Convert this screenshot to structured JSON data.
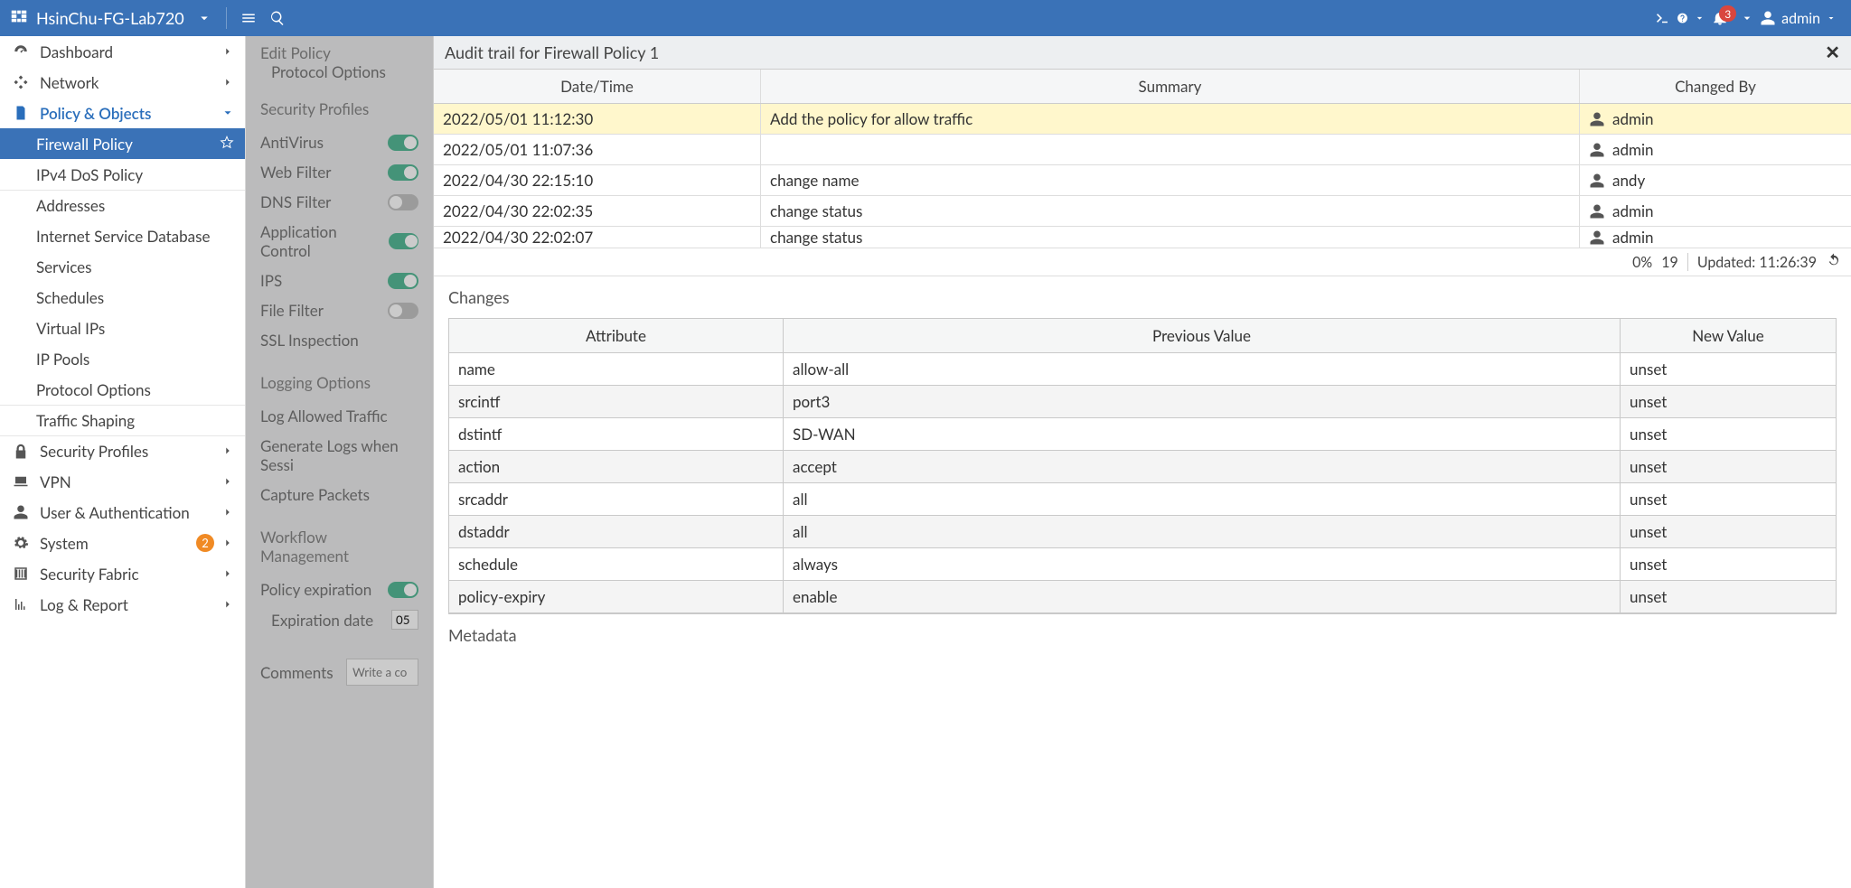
{
  "topbar": {
    "hostname": "HsinChu-FG-Lab720",
    "notif_count": "3",
    "admin_label": "admin"
  },
  "sidebar": {
    "dashboard": "Dashboard",
    "network": "Network",
    "policy_objects": "Policy & Objects",
    "firewall_policy": "Firewall Policy",
    "ipv4_dos": "IPv4 DoS Policy",
    "addresses": "Addresses",
    "isdb": "Internet Service Database",
    "services": "Services",
    "schedules": "Schedules",
    "vip": "Virtual IPs",
    "ippools": "IP Pools",
    "proto_opts": "Protocol Options",
    "traffic_shaping": "Traffic Shaping",
    "security_profiles": "Security Profiles",
    "vpn": "VPN",
    "user_auth": "User & Authentication",
    "system": "System",
    "system_count": "2",
    "security_fabric": "Security Fabric",
    "log_report": "Log & Report"
  },
  "midpanel": {
    "edit_policy": "Edit Policy",
    "protocol_options": "Protocol Options",
    "security_profiles": "Security Profiles",
    "antivirus": "AntiVirus",
    "web_filter": "Web Filter",
    "dns_filter": "DNS Filter",
    "app_control": "Application Control",
    "ips": "IPS",
    "file_filter": "File Filter",
    "ssl_inspection": "SSL Inspection",
    "logging_options": "Logging Options",
    "log_allowed": "Log Allowed Traffic",
    "gen_logs": "Generate Logs when Sessi",
    "capture_packets": "Capture Packets",
    "workflow": "Workflow Management",
    "policy_exp": "Policy expiration",
    "exp_date_label": "Expiration date",
    "exp_date_val": "05",
    "comments": "Comments",
    "comments_ph": "Write a co"
  },
  "panel": {
    "title": "Audit trail for Firewall Policy 1"
  },
  "audit_head": {
    "dt": "Date/Time",
    "sum": "Summary",
    "by": "Changed By"
  },
  "audit_rows": [
    {
      "dt": "2022/05/01 11:12:30",
      "sum": "Add the policy for allow traffic",
      "by": "admin",
      "sel": true
    },
    {
      "dt": "2022/05/01 11:07:36",
      "sum": "",
      "by": "admin"
    },
    {
      "dt": "2022/04/30 22:15:10",
      "sum": "change name",
      "by": "andy"
    },
    {
      "dt": "2022/04/30 22:02:35",
      "sum": "change status",
      "by": "admin"
    },
    {
      "dt": "2022/04/30 22:02:07",
      "sum": "change status",
      "by": "admin"
    }
  ],
  "bar": {
    "pct": "0%",
    "count": "19",
    "updated": "Updated: 11:26:39"
  },
  "changes_h": "Changes",
  "changes_head": {
    "a": "Attribute",
    "p": "Previous Value",
    "n": "New Value"
  },
  "changes": [
    {
      "a": "name",
      "p": "allow-all",
      "n": "unset"
    },
    {
      "a": "srcintf",
      "p": "port3",
      "n": "unset"
    },
    {
      "a": "dstintf",
      "p": "SD-WAN",
      "n": "unset"
    },
    {
      "a": "action",
      "p": "accept",
      "n": "unset"
    },
    {
      "a": "srcaddr",
      "p": "all",
      "n": "unset"
    },
    {
      "a": "dstaddr",
      "p": "all",
      "n": "unset"
    },
    {
      "a": "schedule",
      "p": "always",
      "n": "unset"
    },
    {
      "a": "policy-expiry",
      "p": "enable",
      "n": "unset"
    }
  ],
  "metadata_h": "Metadata"
}
